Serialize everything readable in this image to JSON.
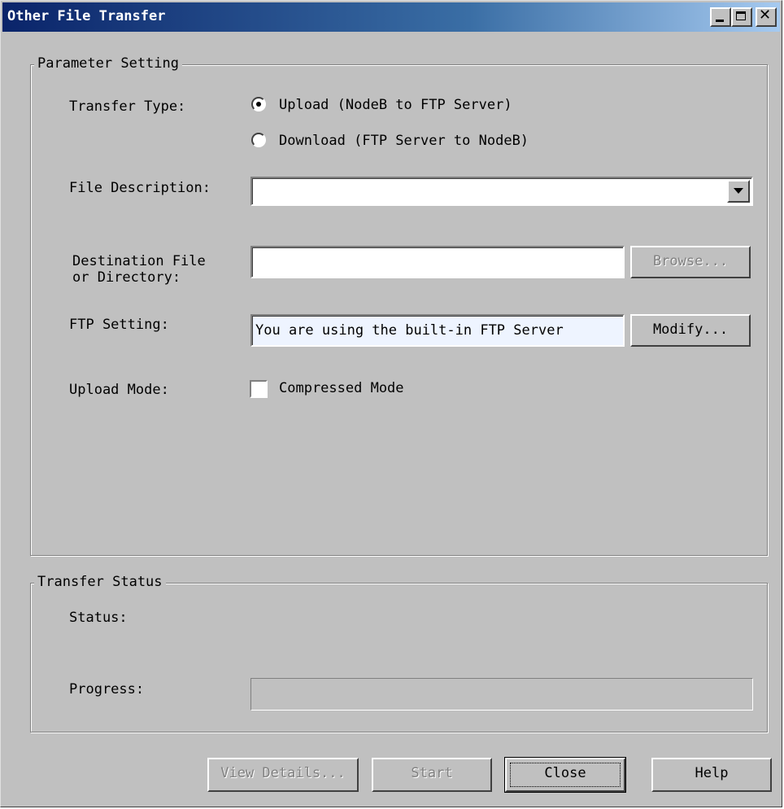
{
  "window": {
    "title": "Other File Transfer"
  },
  "parameter_setting": {
    "legend": "Parameter Setting",
    "transfer_type_label": "Transfer Type:",
    "upload_option": "Upload (NodeB to FTP Server)",
    "download_option": "Download (FTP Server to NodeB)",
    "selected": "upload",
    "file_description_label": "File Description:",
    "file_description_value": "",
    "destination_label_line1": "Destination File",
    "destination_label_line2": "or Directory:",
    "destination_value": "",
    "browse_label": "Browse...",
    "ftp_setting_label": "FTP Setting:",
    "ftp_setting_value": "You are using the built-in FTP Server",
    "modify_label": "Modify...",
    "upload_mode_label": "Upload Mode:",
    "compressed_mode_label": "Compressed Mode",
    "compressed_mode_checked": false
  },
  "transfer_status": {
    "legend": "Transfer Status",
    "status_label": "Status:",
    "status_value": "",
    "progress_label": "Progress:",
    "progress_value": 0
  },
  "footer": {
    "view_details_label": "View Details...",
    "start_label": "Start",
    "close_label": "Close",
    "help_label": "Help"
  },
  "colors": {
    "titlebar_start": "#0a246a",
    "titlebar_end": "#a6caf0",
    "face": "#c0c0c0",
    "ftp_field_bg": "#eef4ff"
  }
}
